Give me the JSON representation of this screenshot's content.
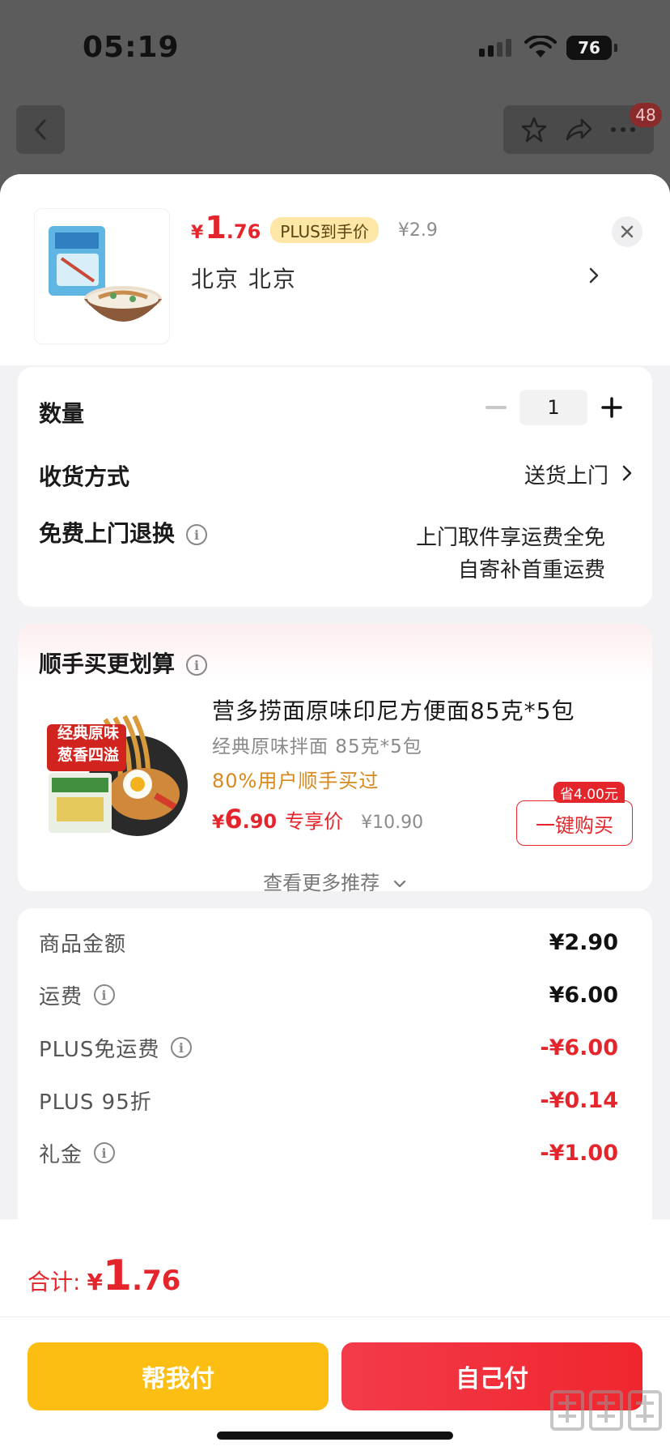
{
  "status": {
    "time": "05:19",
    "battery": "76"
  },
  "topbar": {
    "badge_count": "48"
  },
  "product": {
    "price_yen": "¥",
    "price_int": "1",
    "price_dec": ".76",
    "plus_tag": "PLUS到手价",
    "original_price": "¥2.9",
    "address": "北京  北京"
  },
  "options": {
    "quantity_label": "数量",
    "quantity_value": "1",
    "delivery_label": "收货方式",
    "delivery_value": "送货上门",
    "free_return_label": "免费上门退换",
    "free_return_line1": "上门取件享运费全免",
    "free_return_line2": "自寄补首重运费"
  },
  "recommend": {
    "title": "顺手买更划算",
    "name": "营多捞面原味印尼方便面85克*5包",
    "subtitle": "经典原味拌面 85克*5包",
    "popularity": "80%用户顺手买过",
    "price_yen": "¥",
    "price_int": "6",
    "price_dec": ".90",
    "price_tag": "专享价",
    "original_price": "¥10.90",
    "save_tag": "省4.00元",
    "buy_label": "一键购买",
    "more_label": "查看更多推荐",
    "image_text_1": "经典原味",
    "image_text_2": "葱香四溢"
  },
  "summary": {
    "rows": [
      {
        "label": "商品金额",
        "value": "¥2.90",
        "info": false,
        "red": false
      },
      {
        "label": "运费",
        "value": "¥6.00",
        "info": true,
        "red": false
      },
      {
        "label": "PLUS免运费",
        "value": "-¥6.00",
        "info": true,
        "red": true
      },
      {
        "label": "PLUS 95折",
        "value": "-¥0.14",
        "info": false,
        "red": true
      },
      {
        "label": "礼金",
        "value": "-¥1.00",
        "info": true,
        "red": true
      }
    ]
  },
  "footer": {
    "total_label": "合计:",
    "total_yen": "¥",
    "total_int": "1",
    "total_dec": ".76",
    "help_pay": "帮我付",
    "self_pay": "自己付"
  },
  "colors": {
    "accent_red": "#e4262c",
    "help_yellow": "#fdbe14",
    "plus_gold": "#fde6a6",
    "popularity_orange": "#d7891d"
  }
}
